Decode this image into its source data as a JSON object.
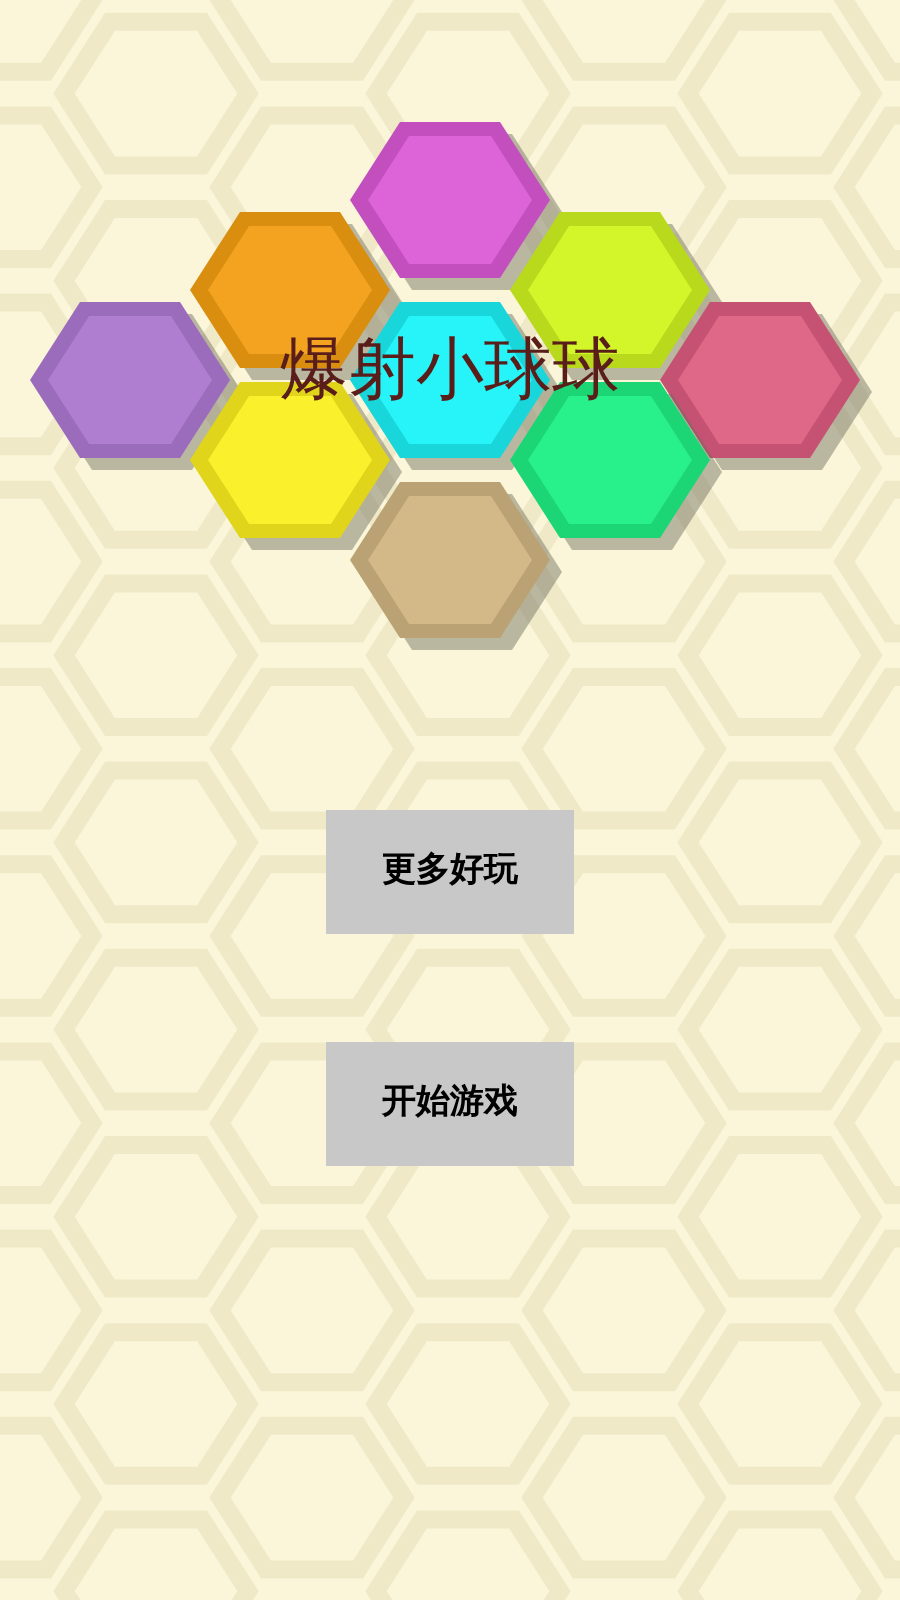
{
  "title": "爆射小球球",
  "buttons": [
    {
      "label": "更多好玩"
    },
    {
      "label": "开始游戏"
    }
  ]
}
